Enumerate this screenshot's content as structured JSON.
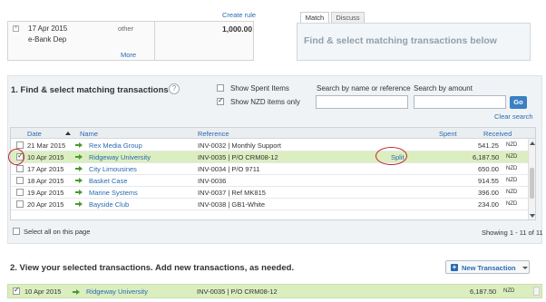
{
  "statement": {
    "date": "17 Apr 2015",
    "description": "e-Bank Dep",
    "type": "other",
    "more_label": "More",
    "amount": "1,000.00",
    "create_rule_label": "Create rule"
  },
  "tabs": [
    {
      "label": "Match"
    },
    {
      "label": "Discuss"
    }
  ],
  "match_panel_title": "Find & select matching transactions below",
  "section1": {
    "title": "1. Find & select matching transactions",
    "show_spent_label": "Show Spent Items",
    "show_spent_checked": false,
    "show_nzd_label": "Show NZD items only",
    "show_nzd_checked": true,
    "search_name_label": "Search by name or reference",
    "search_amount_label": "Search by amount",
    "go_label": "Go",
    "clear_search_label": "Clear search"
  },
  "table": {
    "headers": {
      "date": "Date",
      "name": "Name",
      "reference": "Reference",
      "spent": "Spent",
      "received": "Received"
    },
    "rows": [
      {
        "date": "21 Mar 2015",
        "name": "Rex Media Group",
        "reference": "INV-0032 | Monthly Support",
        "spent": "",
        "received": "541.25",
        "currency": "NZD",
        "selected": false
      },
      {
        "date": "10 Apr 2015",
        "name": "Ridgeway University",
        "reference": "INV-0035 | P/O CRM08-12",
        "spent": "Split",
        "received": "6,187.50",
        "currency": "NZD",
        "selected": true
      },
      {
        "date": "17 Apr 2015",
        "name": "City Limousines",
        "reference": "INV-0034 | P/O 9711",
        "spent": "",
        "received": "650.00",
        "currency": "NZD",
        "selected": false
      },
      {
        "date": "18 Apr 2015",
        "name": "Basket Case",
        "reference": "INV-0036",
        "spent": "",
        "received": "914.55",
        "currency": "NZD",
        "selected": false
      },
      {
        "date": "19 Apr 2015",
        "name": "Marine Systems",
        "reference": "INV-0037 | Ref MK815",
        "spent": "",
        "received": "396.00",
        "currency": "NZD",
        "selected": false
      },
      {
        "date": "20 Apr 2015",
        "name": "Bayside Club",
        "reference": "INV-0038 | GB1-White",
        "spent": "",
        "received": "234.00",
        "currency": "NZD",
        "selected": false
      }
    ],
    "select_all_label": "Select all on this page",
    "showing_label": "Showing 1 - 11 of 11"
  },
  "section2": {
    "title": "2. View your selected transactions. Add new transactions, as needed.",
    "new_transaction_label": "New Transaction",
    "selected_row": {
      "date": "10 Apr 2015",
      "name": "Ridgeway University",
      "reference": "INV-0035 | P/O CRM08-12",
      "received": "6,187.50",
      "currency": "NZD"
    }
  }
}
